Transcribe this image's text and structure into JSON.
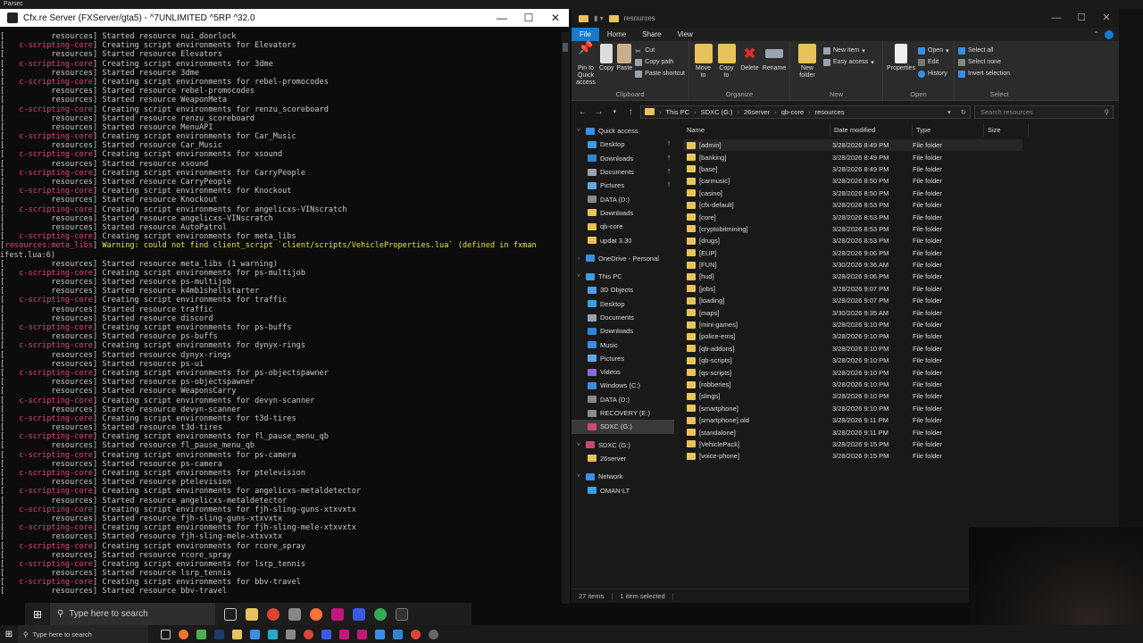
{
  "parsec": {
    "title": "Parsec"
  },
  "console": {
    "title": "Cfx.re Server (FXServer/gta5) - ^7UNLIMITED ^5RP ^32.0",
    "lines": [
      {
        "tag": "resources",
        "kind": "res",
        "text": "Started resource nui_doorlock"
      },
      {
        "tag": "c-scripting-core",
        "kind": "core",
        "text": "Creating script environments for Elevators"
      },
      {
        "tag": "resources",
        "kind": "res",
        "text": "Started resource Elevators"
      },
      {
        "tag": "c-scripting-core",
        "kind": "core",
        "text": "Creating script environments for 3dme"
      },
      {
        "tag": "resources",
        "kind": "res",
        "text": "Started resource 3dme"
      },
      {
        "tag": "c-scripting-core",
        "kind": "core",
        "text": "Creating script environments for rebel-promocodes"
      },
      {
        "tag": "resources",
        "kind": "res",
        "text": "Started resource rebel-promocodes"
      },
      {
        "tag": "resources",
        "kind": "res",
        "text": "Started resource WeaponMeta"
      },
      {
        "tag": "c-scripting-core",
        "kind": "core",
        "text": "Creating script environments for renzu_scoreboard"
      },
      {
        "tag": "resources",
        "kind": "res",
        "text": "Started resource renzu_scoreboard"
      },
      {
        "tag": "resources",
        "kind": "res",
        "text": "Started resource MenuAPI"
      },
      {
        "tag": "c-scripting-core",
        "kind": "core",
        "text": "Creating script environments for Car_Music"
      },
      {
        "tag": "resources",
        "kind": "res",
        "text": "Started resource Car_Music"
      },
      {
        "tag": "c-scripting-core",
        "kind": "core",
        "text": "Creating script environments for xsound"
      },
      {
        "tag": "resources",
        "kind": "res",
        "text": "Started resource xsound"
      },
      {
        "tag": "c-scripting-core",
        "kind": "core",
        "text": "Creating script environments for CarryPeople"
      },
      {
        "tag": "resources",
        "kind": "res",
        "text": "Started resource CarryPeople"
      },
      {
        "tag": "c-scripting-core",
        "kind": "core",
        "text": "Creating script environments for Knockout"
      },
      {
        "tag": "resources",
        "kind": "res",
        "text": "Started resource Knockout"
      },
      {
        "tag": "c-scripting-core",
        "kind": "core",
        "text": "Creating script environments for angelicxs-VINscratch"
      },
      {
        "tag": "resources",
        "kind": "res",
        "text": "Started resource angelicxs-VINscratch"
      },
      {
        "tag": "resources",
        "kind": "res",
        "text": "Started resource AutoPatrol"
      },
      {
        "tag": "c-scripting-core",
        "kind": "core",
        "text": "Creating script environments for meta_libs"
      },
      {
        "tag": "resources:meta_libs",
        "kind": "warn",
        "text": "Warning: could not find client_script `client/scripts/VehicleProperties.lua` (defined in fxman"
      },
      {
        "tag": "",
        "kind": "plain",
        "text": "ifest.lua:6)"
      },
      {
        "tag": "resources",
        "kind": "res",
        "text": "Started resource meta_libs (1 warning)"
      },
      {
        "tag": "c-scripting-core",
        "kind": "core",
        "text": "Creating script environments for ps-multijob"
      },
      {
        "tag": "resources",
        "kind": "res",
        "text": "Started resource ps-multijob"
      },
      {
        "tag": "resources",
        "kind": "res",
        "text": "Started resource k4mb1shellstarter"
      },
      {
        "tag": "c-scripting-core",
        "kind": "core",
        "text": "Creating script environments for traffic"
      },
      {
        "tag": "resources",
        "kind": "res",
        "text": "Started resource traffic"
      },
      {
        "tag": "resources",
        "kind": "res",
        "text": "Started resource discord"
      },
      {
        "tag": "c-scripting-core",
        "kind": "core",
        "text": "Creating script environments for ps-buffs"
      },
      {
        "tag": "resources",
        "kind": "res",
        "text": "Started resource ps-buffs"
      },
      {
        "tag": "c-scripting-core",
        "kind": "core",
        "text": "Creating script environments for dynyx-rings"
      },
      {
        "tag": "resources",
        "kind": "res",
        "text": "Started resource dynyx-rings"
      },
      {
        "tag": "resources",
        "kind": "res",
        "text": "Started resource ps-ui"
      },
      {
        "tag": "c-scripting-core",
        "kind": "core",
        "text": "Creating script environments for ps-objectspawner"
      },
      {
        "tag": "resources",
        "kind": "res",
        "text": "Started resource ps-objectspawner"
      },
      {
        "tag": "resources",
        "kind": "res",
        "text": "Started resource WeaponsCarry"
      },
      {
        "tag": "c-scripting-core",
        "kind": "core",
        "text": "Creating script environments for devyn-scanner"
      },
      {
        "tag": "resources",
        "kind": "res",
        "text": "Started resource devyn-scanner"
      },
      {
        "tag": "c-scripting-core",
        "kind": "core",
        "text": "Creating script environments for t3d-tires"
      },
      {
        "tag": "resources",
        "kind": "res",
        "text": "Started resource t3d-tires"
      },
      {
        "tag": "c-scripting-core",
        "kind": "core",
        "text": "Creating script environments for fl_pause_menu_qb"
      },
      {
        "tag": "resources",
        "kind": "res",
        "text": "Started resource fl_pause_menu_qb"
      },
      {
        "tag": "c-scripting-core",
        "kind": "core",
        "text": "Creating script environments for ps-camera"
      },
      {
        "tag": "resources",
        "kind": "res",
        "text": "Started resource ps-camera"
      },
      {
        "tag": "c-scripting-core",
        "kind": "core",
        "text": "Creating script environments for ptelevision"
      },
      {
        "tag": "resources",
        "kind": "res",
        "text": "Started resource ptelevision"
      },
      {
        "tag": "c-scripting-core",
        "kind": "core",
        "text": "Creating script environments for angelicxs-metaldetector"
      },
      {
        "tag": "resources",
        "kind": "res",
        "text": "Started resource angelicxs-metaldetector"
      },
      {
        "tag": "c-scripting-core",
        "kind": "core",
        "text": "Creating script environments for fjh-sling-guns-xtxvxtx"
      },
      {
        "tag": "resources",
        "kind": "res",
        "text": "Started resource fjh-sling-guns-xtxvxtx"
      },
      {
        "tag": "c-scripting-core",
        "kind": "core",
        "text": "Creating script environments for fjh-sling-mele-xtxvxtx"
      },
      {
        "tag": "resources",
        "kind": "res",
        "text": "Started resource fjh-sling-mele-xtxvxtx"
      },
      {
        "tag": "c-scripting-core",
        "kind": "core",
        "text": "Creating script environments for rcore_spray"
      },
      {
        "tag": "resources",
        "kind": "res",
        "text": "Started resource rcore_spray"
      },
      {
        "tag": "c-scripting-core",
        "kind": "core",
        "text": "Creating script environments for lsrp_tennis"
      },
      {
        "tag": "resources",
        "kind": "res",
        "text": "Started resource lsrp_tennis"
      },
      {
        "tag": "c-scripting-core",
        "kind": "core",
        "text": "Creating script environments for bbv-travel"
      },
      {
        "tag": "resources",
        "kind": "res",
        "text": "Started resource bbv-travel"
      }
    ]
  },
  "explorer": {
    "title": "resources",
    "tabs": [
      "File",
      "Home",
      "Share",
      "View"
    ],
    "active_tab": "File",
    "ribbon": {
      "clipboard": {
        "label": "Clipboard",
        "pin": "Pin to Quick access",
        "copy": "Copy",
        "paste": "Paste",
        "cut": "Cut",
        "copy_path": "Copy path",
        "paste_shortcut": "Paste shortcut"
      },
      "organize": {
        "label": "Organize",
        "move_to": "Move to",
        "copy_to": "Copy to",
        "delete": "Delete",
        "rename": "Rename"
      },
      "new": {
        "label": "New",
        "new_folder": "New folder",
        "new_item": "New item",
        "easy_access": "Easy access"
      },
      "open": {
        "label": "Open",
        "properties": "Properties",
        "open": "Open",
        "edit": "Edit",
        "history": "History"
      },
      "select": {
        "label": "Select",
        "select_all": "Select all",
        "select_none": "Select none",
        "invert": "Invert selection"
      }
    },
    "path": [
      "This PC",
      "SDXC (G:)",
      "26server",
      "qb-core",
      "resources"
    ],
    "search_placeholder": "Search resources",
    "columns": {
      "name": "Name",
      "date": "Date modified",
      "type": "Type",
      "size": "Size"
    },
    "nav": [
      {
        "label": "Quick access",
        "icon": "star-icon",
        "color": "#3a8ee6",
        "indent": 0,
        "chev": "v"
      },
      {
        "label": "Desktop",
        "icon": "desktop-icon",
        "color": "#3aa0e6",
        "indent": 1,
        "pin": true
      },
      {
        "label": "Downloads",
        "icon": "download-icon",
        "color": "#2f86d8",
        "indent": 1,
        "pin": true
      },
      {
        "label": "Documents",
        "icon": "documents-icon",
        "color": "#9aa4b0",
        "indent": 1,
        "pin": true
      },
      {
        "label": "Pictures",
        "icon": "pictures-icon",
        "color": "#5fa8e6",
        "indent": 1,
        "pin": true
      },
      {
        "label": "DATA (D:)",
        "icon": "drive-icon",
        "color": "#8a8a8a",
        "indent": 1
      },
      {
        "label": "Downloads",
        "icon": "folder-icon",
        "color": "#e8c25a",
        "indent": 1
      },
      {
        "label": "qb-core",
        "icon": "folder-icon",
        "color": "#e8c25a",
        "indent": 1
      },
      {
        "label": "updat 3.30",
        "icon": "folder-icon",
        "color": "#e8c25a",
        "indent": 1
      },
      {
        "gap": true
      },
      {
        "label": "OneDrive - Personal",
        "icon": "cloud-icon",
        "color": "#3a8ee6",
        "indent": 0,
        "chev": ">"
      },
      {
        "gap": true
      },
      {
        "label": "This PC",
        "icon": "computer-icon",
        "color": "#3aa0e6",
        "indent": 0,
        "chev": "v"
      },
      {
        "label": "3D Objects",
        "icon": "cube-icon",
        "color": "#4fa0e0",
        "indent": 1
      },
      {
        "label": "Desktop",
        "icon": "desktop-icon",
        "color": "#3aa0e6",
        "indent": 1
      },
      {
        "label": "Documents",
        "icon": "documents-icon",
        "color": "#9aa4b0",
        "indent": 1
      },
      {
        "label": "Downloads",
        "icon": "download-icon",
        "color": "#2f86d8",
        "indent": 1
      },
      {
        "label": "Music",
        "icon": "music-icon",
        "color": "#3a8ee6",
        "indent": 1
      },
      {
        "label": "Pictures",
        "icon": "pictures-icon",
        "color": "#5fa8e6",
        "indent": 1
      },
      {
        "label": "Videos",
        "icon": "video-icon",
        "color": "#8a6ad8",
        "indent": 1
      },
      {
        "label": "Windows (C:)",
        "icon": "drive-icon",
        "color": "#3a8ee6",
        "indent": 1
      },
      {
        "label": "DATA (D:)",
        "icon": "drive-icon",
        "color": "#8a8a8a",
        "indent": 1
      },
      {
        "label": "RECOVERY (E:)",
        "icon": "drive-icon",
        "color": "#8a8a8a",
        "indent": 1
      },
      {
        "label": "SDXC (G:)",
        "icon": "sd-icon",
        "color": "#c84a7a",
        "indent": 1,
        "sel": true
      },
      {
        "gap": true
      },
      {
        "label": "SDXC (G:)",
        "icon": "sd-icon",
        "color": "#c84a7a",
        "indent": 0,
        "chev": "v"
      },
      {
        "label": "26server",
        "icon": "folder-icon",
        "color": "#e8c25a",
        "indent": 1
      },
      {
        "gap": true
      },
      {
        "label": "Network",
        "icon": "network-icon",
        "color": "#3a8ee6",
        "indent": 0,
        "chev": "v"
      },
      {
        "label": "OMAN-LT",
        "icon": "computer-icon",
        "color": "#3aa0e6",
        "indent": 1
      }
    ],
    "files": [
      {
        "name": "[admin]",
        "date": "3/28/2026 8:49 PM",
        "type": "File folder",
        "sel": true
      },
      {
        "name": "[banking]",
        "date": "3/28/2026 8:49 PM",
        "type": "File folder"
      },
      {
        "name": "[base]",
        "date": "3/28/2026 8:49 PM",
        "type": "File folder"
      },
      {
        "name": "[carmusic]",
        "date": "3/28/2026 8:50 PM",
        "type": "File folder"
      },
      {
        "name": "[casino]",
        "date": "3/28/2026 8:50 PM",
        "type": "File folder"
      },
      {
        "name": "[cfx-default]",
        "date": "3/28/2026 8:53 PM",
        "type": "File folder"
      },
      {
        "name": "[core]",
        "date": "3/28/2026 8:53 PM",
        "type": "File folder"
      },
      {
        "name": "[cryptobitmining]",
        "date": "3/28/2026 8:53 PM",
        "type": "File folder"
      },
      {
        "name": "[drugs]",
        "date": "3/28/2026 8:53 PM",
        "type": "File folder"
      },
      {
        "name": "[EUP]",
        "date": "3/28/2026 9:06 PM",
        "type": "File folder"
      },
      {
        "name": "[FUN]",
        "date": "3/30/2026 9:36 AM",
        "type": "File folder"
      },
      {
        "name": "[hud]",
        "date": "3/28/2026 9:06 PM",
        "type": "File folder"
      },
      {
        "name": "[jobs]",
        "date": "3/28/2026 9:07 PM",
        "type": "File folder"
      },
      {
        "name": "[loading]",
        "date": "3/28/2026 9:07 PM",
        "type": "File folder"
      },
      {
        "name": "[maps]",
        "date": "3/30/2026 9:35 AM",
        "type": "File folder"
      },
      {
        "name": "[mini-games]",
        "date": "3/28/2026 9:10 PM",
        "type": "File folder"
      },
      {
        "name": "[police-ems]",
        "date": "3/28/2026 9:10 PM",
        "type": "File folder"
      },
      {
        "name": "[qb-addons]",
        "date": "3/28/2026 9:10 PM",
        "type": "File folder"
      },
      {
        "name": "[qb-scripts]",
        "date": "3/28/2026 9:10 PM",
        "type": "File folder"
      },
      {
        "name": "[qs-scripts]",
        "date": "3/28/2026 9:10 PM",
        "type": "File folder"
      },
      {
        "name": "[robberies]",
        "date": "3/28/2026 9:10 PM",
        "type": "File folder"
      },
      {
        "name": "[slings]",
        "date": "3/28/2026 9:10 PM",
        "type": "File folder"
      },
      {
        "name": "[smartphone]",
        "date": "3/28/2026 9:10 PM",
        "type": "File folder"
      },
      {
        "name": "[smartphone].old",
        "date": "3/28/2026 9:11 PM",
        "type": "File folder"
      },
      {
        "name": "[standalone]",
        "date": "3/28/2026 9:11 PM",
        "type": "File folder"
      },
      {
        "name": "[VehiclePack]",
        "date": "3/28/2026 9:15 PM",
        "type": "File folder"
      },
      {
        "name": "[voice-phone]",
        "date": "3/28/2026 9:15 PM",
        "type": "File folder"
      }
    ],
    "status": {
      "count": "27 items",
      "selected": "1 item selected"
    }
  },
  "inner_taskbar": {
    "search_placeholder": "Type here to search"
  },
  "outer_taskbar": {
    "search_placeholder": "Type here to search"
  },
  "colors": {
    "accent": "#1979ca",
    "core_tag": "#e0467c",
    "warning": "#e8e24a",
    "folder": "#e8c25a"
  }
}
